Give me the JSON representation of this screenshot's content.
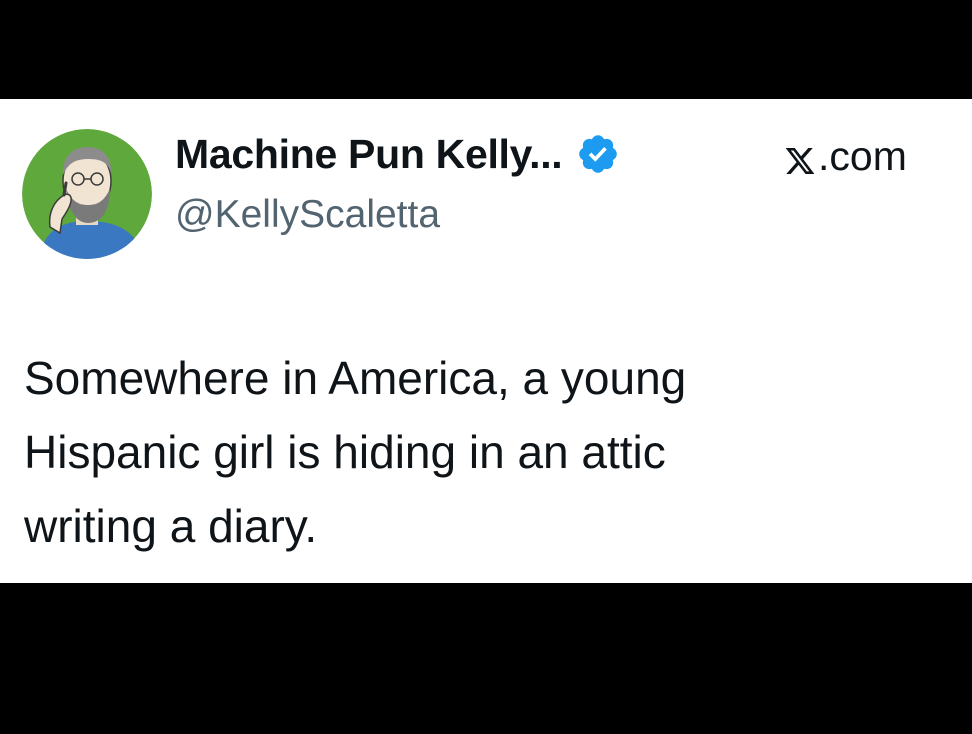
{
  "tweet": {
    "display_name": "Machine Pun Kelly...",
    "handle": "@KellyScaletta",
    "source": ".com",
    "text_lines": [
      "Somewhere in America, a young",
      "Hispanic girl is hiding in an attic",
      "writing a diary."
    ]
  },
  "icons": {
    "avatar": "avatar-bearded-man-illustration",
    "verified": "verified-badge-icon",
    "brand": "x-logo-icon"
  },
  "colors": {
    "background": "#000000",
    "card": "#ffffff",
    "text_primary": "#0f1419",
    "text_secondary": "#536471",
    "verified_blue": "#1d9bf0",
    "avatar_green": "#5fa83c",
    "shirt_blue": "#3a78c2"
  }
}
